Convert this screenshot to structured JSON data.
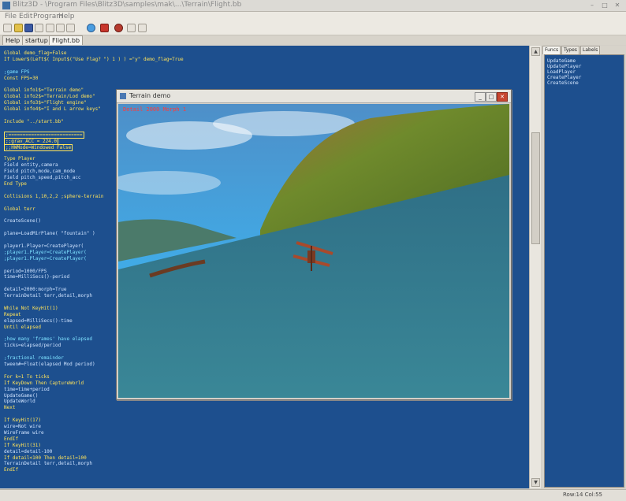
{
  "window": {
    "title": "Blitz3D - \\Program Files\\Blitz3D\\samples\\mak\\...\\Terrain\\Flight.bb"
  },
  "menu": {
    "items": [
      "File",
      "Edit",
      "Program",
      "Help"
    ]
  },
  "toolbar": {
    "icons": [
      "new-icon",
      "open-icon",
      "save-icon",
      "close-icon",
      "cut-icon",
      "copy-icon",
      "paste-icon",
      "find-icon",
      "run-icon",
      "stop-icon",
      "debug-icon",
      "help-icon"
    ]
  },
  "tabs": [
    "Help",
    "startup",
    "Flight.bb"
  ],
  "editor": {
    "lines": [
      "Global demo_flag=False",
      "If Lower$(Left$( Input$(\"Use Flag? \") 1 ) ) =\"y\" demo_flag=True",
      "",
      ";game FPS",
      "Const FPS=30",
      "",
      "Global info1$=\"Terrain demo\"",
      "Global info2$=\"Terrain/Lod demo\"",
      "Global info3$=\"Flight engine\"",
      "Global info4$=\"I and L arrow keys\"",
      "",
      "Include \"../start.bb\"",
      "",
      ";==========================",
      ";;grav_ACC = 224.0",
      ";;HWMode=Windowed False",
      "",
      "Type Player",
      "    Field entity,camera",
      "    Field pitch,mode,cam_mode",
      "    Field pitch_speed,pitch_acc",
      "End Type",
      "",
      "Collisions 1,10,2,2 ;sphere-terrain",
      "",
      "Global terr",
      "",
      "CreateScene()",
      "",
      "plane=LoadMirPlane( \"fountain\" )",
      "",
      "player1.Player=CreatePlayer(",
      ";player1.Player=CreatePlayer(",
      ";player1.Player=CreatePlayer(",
      "",
      "period=1000/FPS",
      "time=MilliSecs()-period",
      "",
      "detail=2000:morph=True",
      "TerrainDetail terr,detail,morph",
      "",
      "While Not KeyHit(1)",
      "    Repeat",
      "        elapsed=MilliSecs()-time",
      "    Until elapsed",
      "",
      "    ;how many 'frames' have elapsed",
      "    ticks=elapsed/period",
      "",
      "    ;fractional remainder",
      "    tween#=Float(elapsed Mod period)",
      "",
      "    For k=1 To ticks",
      "        If KeyDown Then CaptureWorld",
      "        time=time+period",
      "        UpdateGame()",
      "        UpdateWorld",
      "    Next",
      "",
      "    If KeyHit(17)",
      "        wire=Not wire",
      "        WireFrame wire",
      "    EndIf",
      "    If KeyHit(31)",
      "        detail=detail-100",
      "        If detail<100 Then detail=100",
      "        TerrainDetail terr,detail,morph",
      "    EndIf"
    ]
  },
  "right_panel": {
    "tabs": [
      "Funcs",
      "Types",
      "Labels"
    ],
    "items": [
      "UpdateGame",
      "UpdatePlayer",
      "LoadPlayer",
      "CreatePlayer",
      "CreateScene"
    ]
  },
  "status": {
    "position": "Row:14 Col:55"
  },
  "demo_window": {
    "title": "Terrain demo",
    "info_text": "Detail 2000 Morph 1",
    "colors": {
      "sky_top": "#4e8fc8",
      "sky_bottom": "#36c1ff",
      "water": "#2f6f86",
      "hill": "#6f8a2c"
    }
  }
}
